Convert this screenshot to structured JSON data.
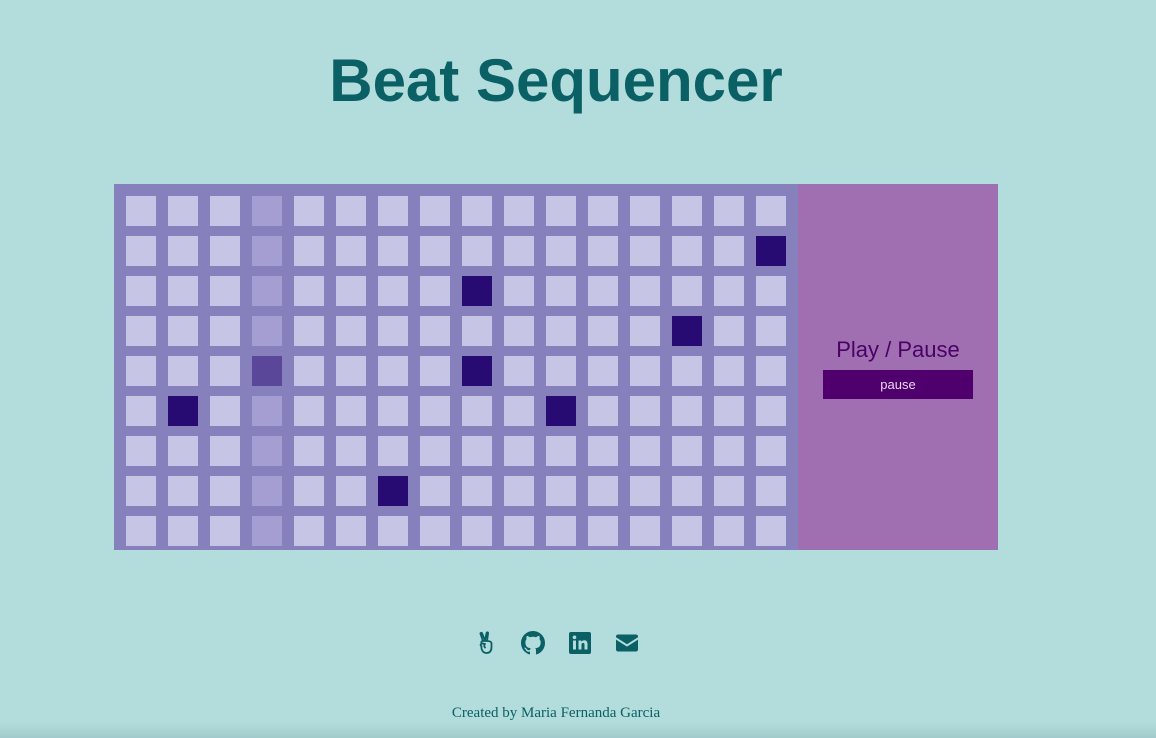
{
  "header": {
    "title": "Beat Sequencer"
  },
  "sequencer": {
    "columns": 16,
    "rows": 9,
    "current_step": 3,
    "active_cells": [
      [
        1,
        15
      ],
      [
        2,
        8
      ],
      [
        3,
        13
      ],
      [
        4,
        3
      ],
      [
        4,
        8
      ],
      [
        5,
        1
      ],
      [
        5,
        10
      ],
      [
        7,
        6
      ]
    ],
    "colors": {
      "grid_background": "#8680bc",
      "cell_off": "#c7c5e5",
      "cell_current_step": "#a49ed2",
      "cell_on": "#270b72",
      "cell_on_current_step": "#5b4799",
      "control_background": "#9f6fb1"
    }
  },
  "controls": {
    "label": "Play / Pause",
    "button_label": "pause"
  },
  "social": {
    "icons": [
      "angellist-icon",
      "github-icon",
      "linkedin-icon",
      "envelope-icon"
    ],
    "color": "#0a6064"
  },
  "footer": {
    "credit": "Created by Maria Fernanda Garcia"
  }
}
